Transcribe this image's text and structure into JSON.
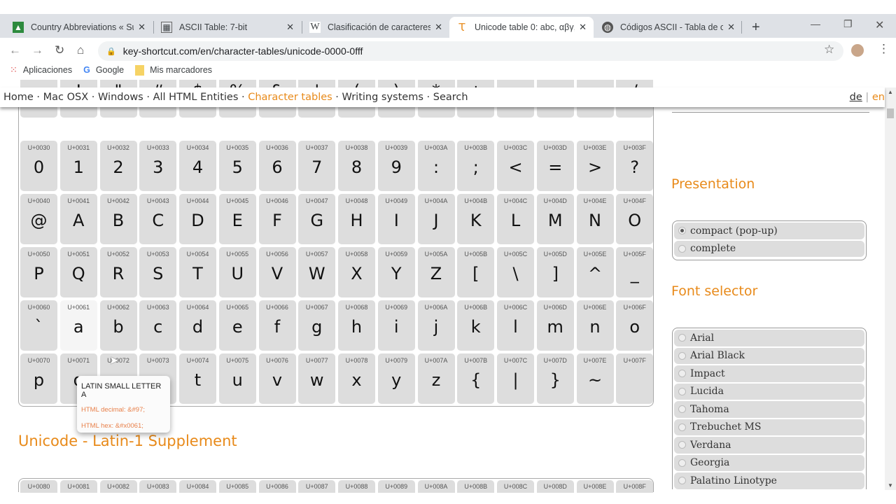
{
  "browser": {
    "tabs": [
      {
        "title": "Country Abbreviations « Su",
        "icon": "chart-favicon"
      },
      {
        "title": "ASCII Table: 7-bit",
        "icon": "table-favicon"
      },
      {
        "title": "Clasificación de caracteres",
        "icon": "W"
      },
      {
        "title": "Unicode table 0: abc, αβγ, ",
        "icon": "Ꚍ",
        "active": true
      },
      {
        "title": "Códigos ASCII - Tabla de c",
        "icon": "globe-favicon"
      }
    ],
    "new_tab": "+",
    "url": "key-shortcut.com/en/character-tables/unicode-0000-0fff",
    "bookmarks": [
      "Aplicaciones",
      "Google",
      "Mis marcadores"
    ],
    "google_g": "G"
  },
  "nav": {
    "items": [
      "Home",
      "Mac OSX",
      "Windows",
      "All HTML Entities",
      "Character tables",
      "Writing systems",
      "Search"
    ],
    "separator": " · ",
    "lang_de": "de",
    "lang_sep": " | ",
    "lang_en": "en"
  },
  "table": {
    "rows": [
      {
        "codes": [
          "",
          "",
          "",
          "",
          "",
          "",
          "",
          "",
          "",
          "",
          "",
          "",
          "",
          "",
          "",
          ""
        ],
        "chars": [
          "",
          " !",
          "\"",
          "#",
          "$",
          "%",
          "&",
          "'",
          "(",
          ")",
          "*",
          "+",
          ",",
          "-",
          ".",
          "/"
        ]
      },
      {
        "codes": [
          "U+0030",
          "U+0031",
          "U+0032",
          "U+0033",
          "U+0034",
          "U+0035",
          "U+0036",
          "U+0037",
          "U+0038",
          "U+0039",
          "U+003A",
          "U+003B",
          "U+003C",
          "U+003D",
          "U+003E",
          "U+003F"
        ],
        "chars": [
          "0",
          "1",
          "2",
          "3",
          "4",
          "5",
          "6",
          "7",
          "8",
          "9",
          ":",
          ";",
          "<",
          "=",
          ">",
          "?"
        ]
      },
      {
        "codes": [
          "U+0040",
          "U+0041",
          "U+0042",
          "U+0043",
          "U+0044",
          "U+0045",
          "U+0046",
          "U+0047",
          "U+0048",
          "U+0049",
          "U+004A",
          "U+004B",
          "U+004C",
          "U+004D",
          "U+004E",
          "U+004F"
        ],
        "chars": [
          "@",
          "A",
          "B",
          "C",
          "D",
          "E",
          "F",
          "G",
          "H",
          "I",
          "J",
          "K",
          "L",
          "M",
          "N",
          "O"
        ]
      },
      {
        "codes": [
          "U+0050",
          "U+0051",
          "U+0052",
          "U+0053",
          "U+0054",
          "U+0055",
          "U+0056",
          "U+0057",
          "U+0058",
          "U+0059",
          "U+005A",
          "U+005B",
          "U+005C",
          "U+005D",
          "U+005E",
          "U+005F"
        ],
        "chars": [
          "P",
          "Q",
          "R",
          "S",
          "T",
          "U",
          "V",
          "W",
          "X",
          "Y",
          "Z",
          "[",
          "\\",
          "]",
          "^",
          "_"
        ]
      },
      {
        "codes": [
          "U+0060",
          "U+0061",
          "U+0062",
          "U+0063",
          "U+0064",
          "U+0065",
          "U+0066",
          "U+0067",
          "U+0068",
          "U+0069",
          "U+006A",
          "U+006B",
          "U+006C",
          "U+006D",
          "U+006E",
          "U+006F"
        ],
        "chars": [
          "`",
          "a",
          "b",
          "c",
          "d",
          "e",
          "f",
          "g",
          "h",
          "i",
          "j",
          "k",
          "l",
          "m",
          "n",
          "o"
        ]
      },
      {
        "codes": [
          "U+0070",
          "U+0071",
          "U+0072",
          "U+0073",
          "U+0074",
          "U+0075",
          "U+0076",
          "U+0077",
          "U+0078",
          "U+0079",
          "U+007A",
          "U+007B",
          "U+007C",
          "U+007D",
          "U+007E",
          "U+007F"
        ],
        "chars": [
          "p",
          "q",
          "r",
          "s",
          "t",
          "u",
          "v",
          "w",
          "x",
          "y",
          "z",
          "{",
          "|",
          "}",
          "~",
          ""
        ]
      }
    ],
    "hovered": "U+0061",
    "tooltip": {
      "name": "LATIN SMALL LETTER A",
      "decimal": "HTML decimal: &#97;",
      "hex": "HTML hex: &#x0061;"
    }
  },
  "section2": {
    "title": "Unicode - Latin-1 Supplement",
    "codes": [
      "U+0080",
      "U+0081",
      "U+0082",
      "U+0083",
      "U+0084",
      "U+0085",
      "U+0086",
      "U+0087",
      "U+0088",
      "U+0089",
      "U+008A",
      "U+008B",
      "U+008C",
      "U+008D",
      "U+008E",
      "U+008F"
    ]
  },
  "sidebar": {
    "presentation_title": "Presentation",
    "presentation_options": [
      {
        "label": "compact (pop-up)",
        "selected": true
      },
      {
        "label": "complete",
        "selected": false
      }
    ],
    "font_title": "Font selector",
    "fonts": [
      "Arial",
      "Arial Black",
      "Impact",
      "Lucida",
      "Tahoma",
      "Trebuchet MS",
      "Verdana",
      "Georgia",
      "Palatino Linotype"
    ]
  },
  "colors": {
    "accent": "#e88a1a",
    "cell": "#dddddd"
  }
}
